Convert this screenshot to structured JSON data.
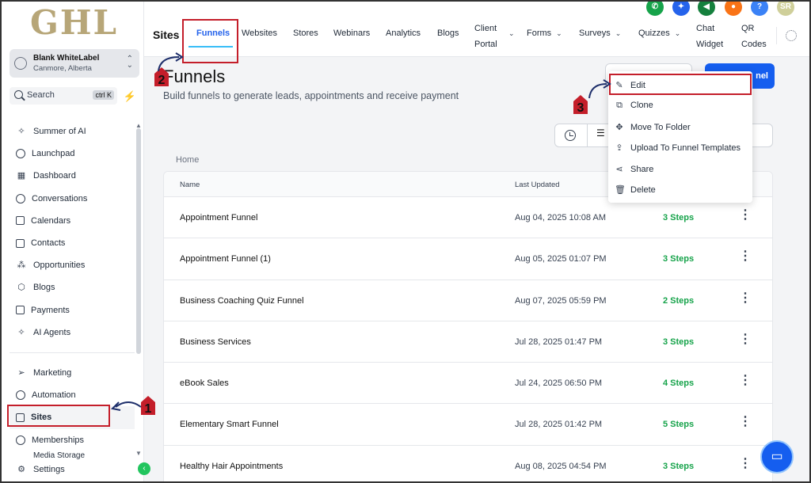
{
  "sidebar": {
    "logo": "GHL",
    "account": {
      "name": "Blank WhiteLabel",
      "location": "Canmore, Alberta"
    },
    "search": {
      "label": "Search",
      "shortcut": "ctrl K"
    },
    "items": [
      {
        "label": "Summer of AI",
        "icon": "sparkle-icon"
      },
      {
        "label": "Launchpad",
        "icon": "rocket-icon"
      },
      {
        "label": "Dashboard",
        "icon": "dashboard-icon"
      },
      {
        "label": "Conversations",
        "icon": "chat-bubble-icon"
      },
      {
        "label": "Calendars",
        "icon": "calendar-icon"
      },
      {
        "label": "Contacts",
        "icon": "contacts-icon"
      },
      {
        "label": "Opportunities",
        "icon": "opportunities-icon"
      },
      {
        "label": "Blogs",
        "icon": "cube-icon"
      },
      {
        "label": "Payments",
        "icon": "payments-icon"
      },
      {
        "label": "AI Agents",
        "icon": "sparkle-icon"
      }
    ],
    "items2": [
      {
        "label": "Marketing",
        "icon": "send-icon"
      },
      {
        "label": "Automation",
        "icon": "automation-icon"
      },
      {
        "label": "Sites",
        "icon": "sites-icon"
      },
      {
        "label": "Memberships",
        "icon": "memberships-icon"
      },
      {
        "label": "Media Storage",
        "icon": "media-icon"
      },
      {
        "label": "Settings",
        "icon": "gear-icon"
      }
    ]
  },
  "topnav": {
    "section": "Sites",
    "tabs": [
      {
        "label": "Funnels"
      },
      {
        "label": "Websites"
      },
      {
        "label": "Stores"
      },
      {
        "label": "Webinars"
      },
      {
        "label": "Analytics"
      },
      {
        "label": "Blogs"
      },
      {
        "label_line1": "Client",
        "label_line2": "Portal"
      },
      {
        "label": "Forms"
      },
      {
        "label": "Surveys"
      },
      {
        "label": "Quizzes"
      },
      {
        "label_line1": "Chat",
        "label_line2": "Widget"
      },
      {
        "label_line1": "QR",
        "label_line2": "Codes"
      }
    ],
    "user_initials": "SR",
    "icon_colors": [
      "#16a34a",
      "#2563eb",
      "#15803d",
      "#f97316",
      "#3b82f6",
      "#d1d5a8"
    ]
  },
  "main": {
    "title": "Funnels",
    "subtitle": "Build funnels to generate leads, appointments and receive payment",
    "new_button": "nel",
    "breadcrumb": "Home",
    "columns": {
      "name": "Name",
      "updated": "Last Updated"
    },
    "rows": [
      {
        "name": "Appointment Funnel",
        "updated": "Aug 04, 2025 10:08 AM",
        "steps": "3 Steps"
      },
      {
        "name": "Appointment Funnel (1)",
        "updated": "Aug 05, 2025 01:07 PM",
        "steps": "3 Steps"
      },
      {
        "name": "Business Coaching Quiz Funnel",
        "updated": "Aug 07, 2025 05:59 PM",
        "steps": "2 Steps"
      },
      {
        "name": "Business Services",
        "updated": "Jul 28, 2025 01:47 PM",
        "steps": "3 Steps"
      },
      {
        "name": "eBook Sales",
        "updated": "Jul 24, 2025 06:50 PM",
        "steps": "4 Steps"
      },
      {
        "name": "Elementary Smart Funnel",
        "updated": "Jul 28, 2025 01:42 PM",
        "steps": "5 Steps"
      },
      {
        "name": "Healthy Hair Appointments",
        "updated": "Aug 08, 2025 04:54 PM",
        "steps": "3 Steps"
      }
    ]
  },
  "dropdown": {
    "items": [
      {
        "label": "Edit",
        "icon": "pencil-icon"
      },
      {
        "label": "Clone",
        "icon": "copy-icon"
      },
      {
        "label": "Move To Folder",
        "icon": "move-icon"
      },
      {
        "label": "Upload To Funnel Templates",
        "icon": "upload-icon"
      },
      {
        "label": "Share",
        "icon": "share-icon"
      },
      {
        "label": "Delete",
        "icon": "trash-icon"
      }
    ]
  },
  "annotations": {
    "step1": "1",
    "step2": "2",
    "step3": "3",
    "highlight_color": "#c41e2a"
  }
}
